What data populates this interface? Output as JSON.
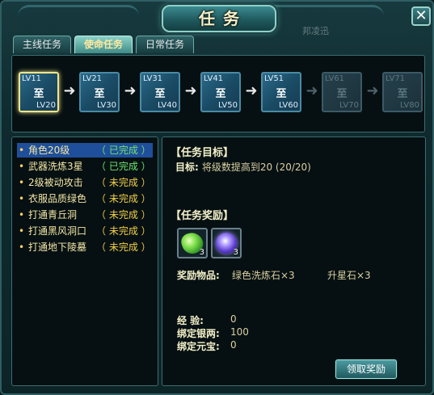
{
  "window": {
    "title": "任务",
    "background_hint": "邦凌迅"
  },
  "close_label": "✕",
  "tabs": [
    {
      "label": "主线任务",
      "active": false
    },
    {
      "label": "使命任务",
      "active": true
    },
    {
      "label": "日常任务",
      "active": false
    }
  ],
  "levels": [
    {
      "low": "LV11",
      "mid": "至",
      "high": "LV20",
      "state": "active"
    },
    {
      "low": "LV21",
      "mid": "至",
      "high": "LV30",
      "state": "unlocked"
    },
    {
      "low": "LV31",
      "mid": "至",
      "high": "LV40",
      "state": "unlocked"
    },
    {
      "low": "LV41",
      "mid": "至",
      "high": "LV50",
      "state": "unlocked"
    },
    {
      "low": "LV51",
      "mid": "至",
      "high": "LV60",
      "state": "unlocked"
    },
    {
      "low": "LV61",
      "mid": "至",
      "high": "LV70",
      "state": "locked"
    },
    {
      "low": "LV71",
      "mid": "至",
      "high": "LV80",
      "state": "locked"
    }
  ],
  "tasks": [
    {
      "name": "角色20级",
      "status": "（ 已完成 ）",
      "done": true,
      "selected": true
    },
    {
      "name": "武器洗炼3星",
      "status": "（ 已完成 ）",
      "done": true,
      "selected": false
    },
    {
      "name": "2级被动攻击",
      "status": "（ 未完成 ）",
      "done": false,
      "selected": false
    },
    {
      "name": "衣服品质绿色",
      "status": "（ 未完成 ）",
      "done": false,
      "selected": false
    },
    {
      "name": "打通青丘洞",
      "status": "（ 未完成 ）",
      "done": false,
      "selected": false
    },
    {
      "name": "打通黑风洞口",
      "status": "（ 未完成 ）",
      "done": false,
      "selected": false
    },
    {
      "name": "打通地下陵墓",
      "status": "（ 未完成 ）",
      "done": false,
      "selected": false
    }
  ],
  "detail": {
    "goal_heading": "【任务目标】",
    "goal_label": "目标:",
    "goal_text": "将级数提高到20 (20/20)",
    "reward_heading": "【任务奖励】",
    "reward_items": [
      {
        "icon": "green-refine-stone-icon",
        "qty": "3"
      },
      {
        "icon": "star-stone-icon",
        "qty": "3"
      }
    ],
    "items_label": "奖励物品:",
    "item_1": "绿色洗炼石×3",
    "item_2": "升星石×3",
    "exp_label": "经    验:",
    "exp_value": "0",
    "silver_label": "绑定银两:",
    "silver_value": "100",
    "ingot_label": "绑定元宝:",
    "ingot_value": "0",
    "claim_button": "领取奖励"
  },
  "colors": {
    "done": "#6fe36f",
    "todo": "#f2cf47",
    "selection": "#1f4f9a",
    "frame": "#3c6c70"
  }
}
